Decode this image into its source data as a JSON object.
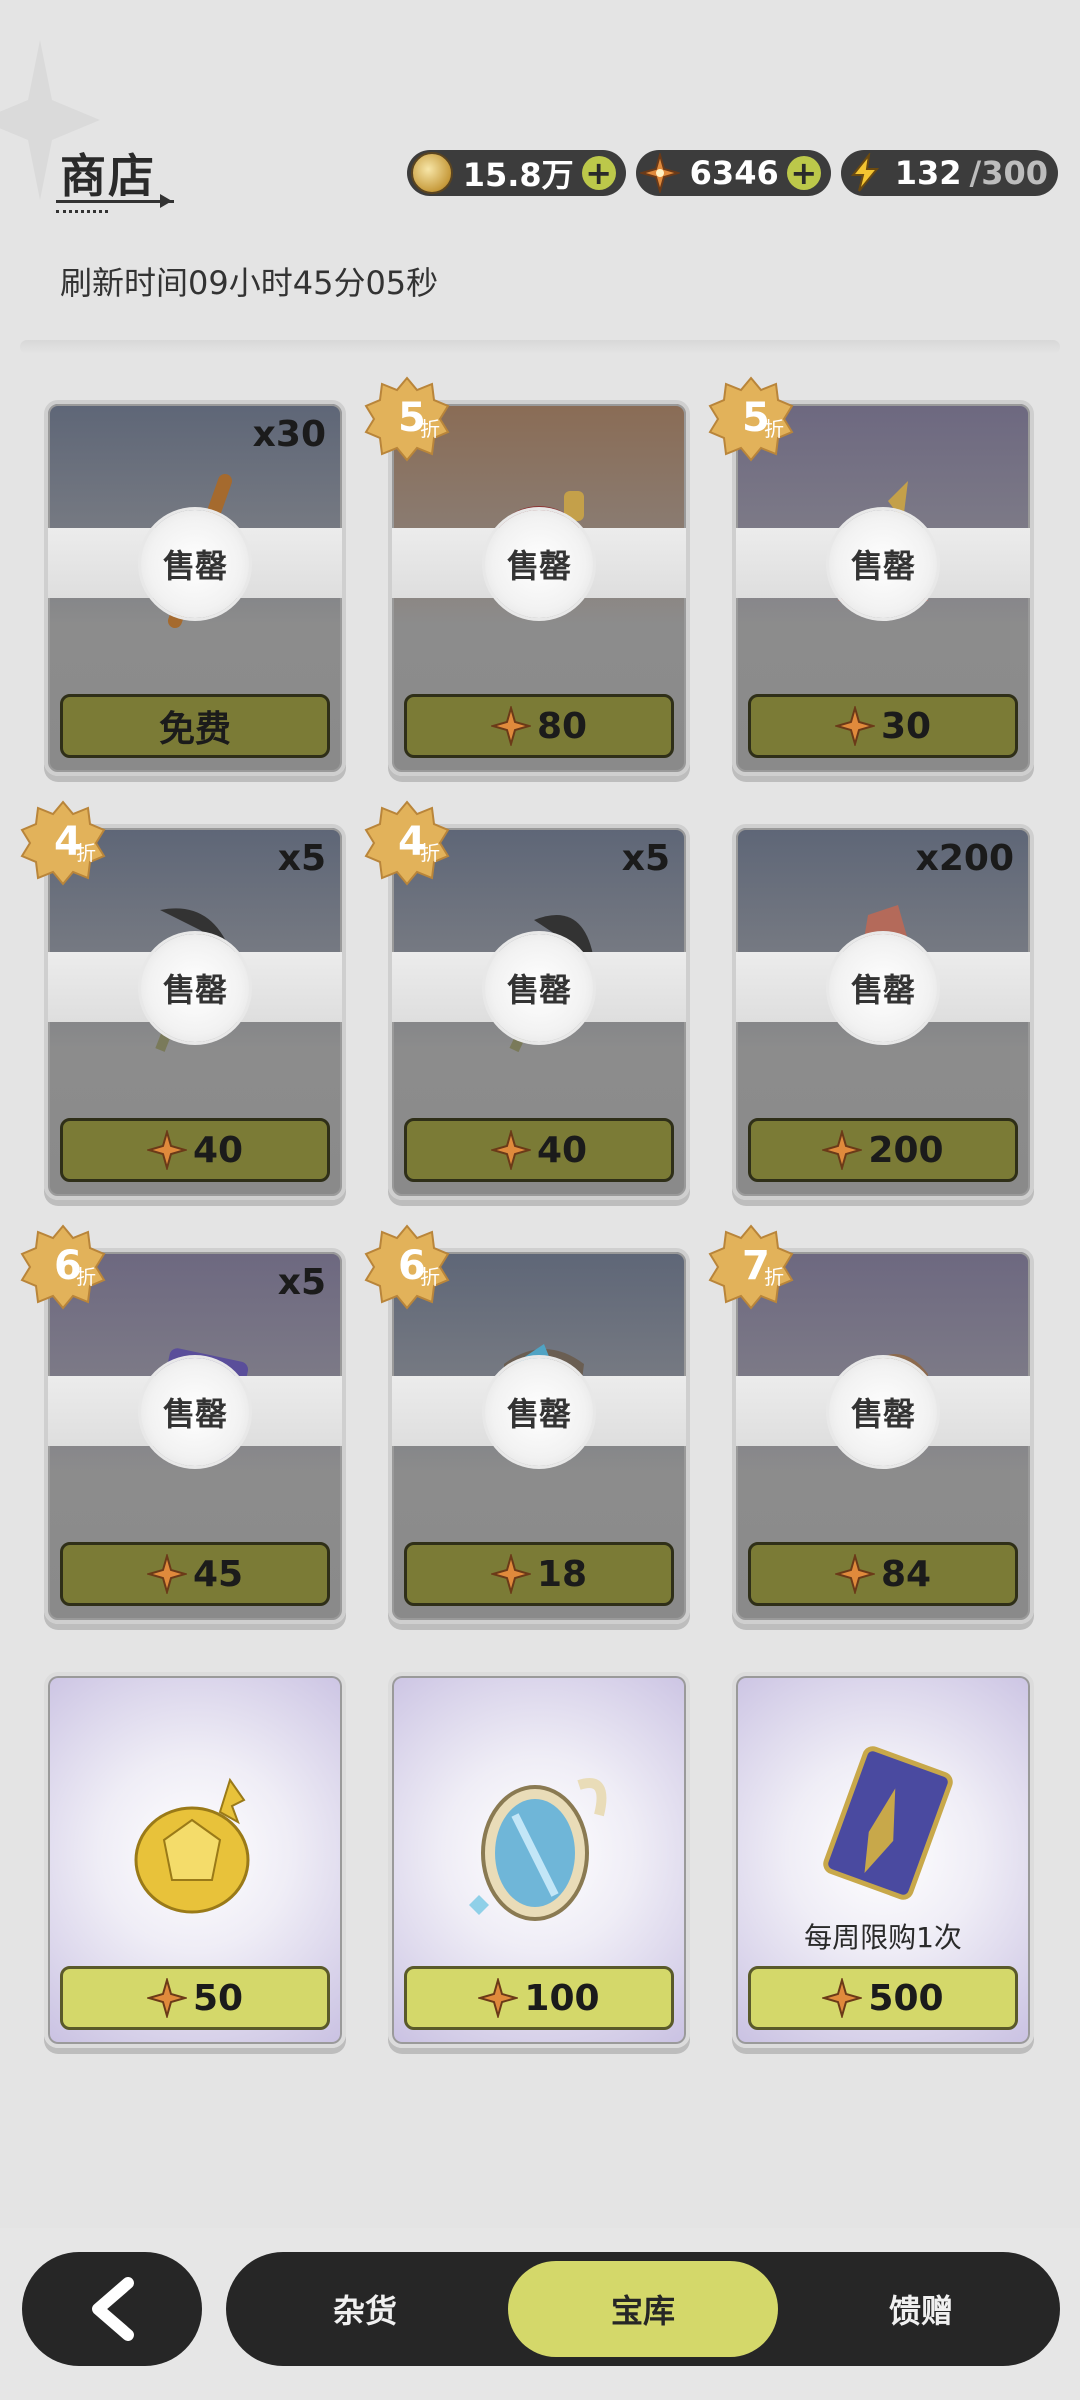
{
  "header": {
    "title": "商店",
    "refresh_text": "刷新时间09小时45分05秒"
  },
  "currencies": [
    {
      "name": "coins",
      "icon": "coin-icon",
      "value": "15.8万"
    },
    {
      "name": "gems",
      "icon": "crystal-star-icon",
      "value": "6346"
    },
    {
      "name": "stamina",
      "icon": "lightning-icon",
      "value": "132",
      "max": "/300"
    }
  ],
  "sold_out_label": "售罄",
  "items": [
    {
      "qty": "x30",
      "discount": "",
      "price": "免费",
      "sold": true
    },
    {
      "qty": "",
      "discount": "5",
      "price": "80",
      "sold": true
    },
    {
      "qty": "",
      "discount": "5",
      "price": "30",
      "sold": true
    },
    {
      "qty": "x5",
      "discount": "4",
      "price": "40",
      "sold": true
    },
    {
      "qty": "x5",
      "discount": "4",
      "price": "40",
      "sold": true
    },
    {
      "qty": "x200",
      "discount": "",
      "price": "200",
      "sold": true
    },
    {
      "qty": "x5",
      "discount": "6",
      "price": "45",
      "sold": true
    },
    {
      "qty": "",
      "discount": "6",
      "price": "18",
      "sold": true
    },
    {
      "qty": "",
      "discount": "7",
      "price": "84",
      "sold": true
    },
    {
      "qty": "",
      "discount": "",
      "price": "50",
      "sold": false,
      "note": ""
    },
    {
      "qty": "",
      "discount": "",
      "price": "100",
      "sold": false,
      "note": ""
    },
    {
      "qty": "",
      "discount": "",
      "price": "500",
      "sold": false,
      "note": "每周限购1次"
    }
  ],
  "discount_suffix": "折",
  "tabs": [
    {
      "label": "杂货",
      "active": false
    },
    {
      "label": "宝库",
      "active": true
    },
    {
      "label": "馈赠",
      "active": false
    }
  ],
  "colors": {
    "accent": "#d4d86a",
    "sold_button": "#7b7b36",
    "tabbar": "#262626"
  }
}
